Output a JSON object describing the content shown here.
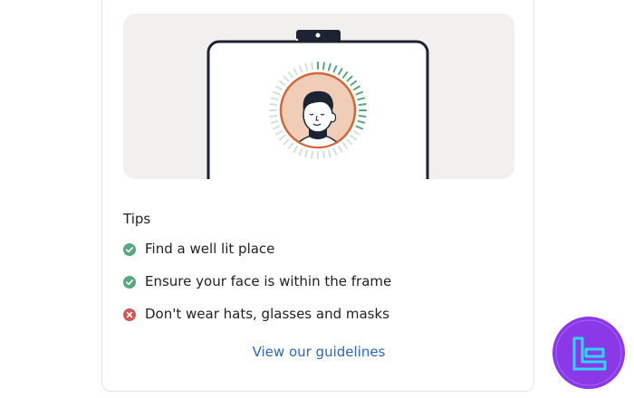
{
  "tips": {
    "heading": "Tips",
    "items": [
      {
        "text": "Find a well lit place",
        "status": "ok",
        "icon": "check-circle-icon"
      },
      {
        "text": "Ensure your face is within the frame",
        "status": "ok",
        "icon": "check-circle-icon"
      },
      {
        "text": "Don't wear hats, glasses and masks",
        "status": "bad",
        "icon": "x-circle-icon"
      }
    ]
  },
  "guidelines_link": "View our guidelines",
  "colors": {
    "ok": "#5aa77f",
    "bad": "#d05a56",
    "link": "#2b66c4",
    "badge": "#8a38e8",
    "badge_logo": "#2fd6f0",
    "illustration_bg": "#f2f0ee",
    "phone_outline": "#1c2333",
    "avatar_ring": "#d2663a",
    "avatar_fill": "#efcdb6"
  }
}
